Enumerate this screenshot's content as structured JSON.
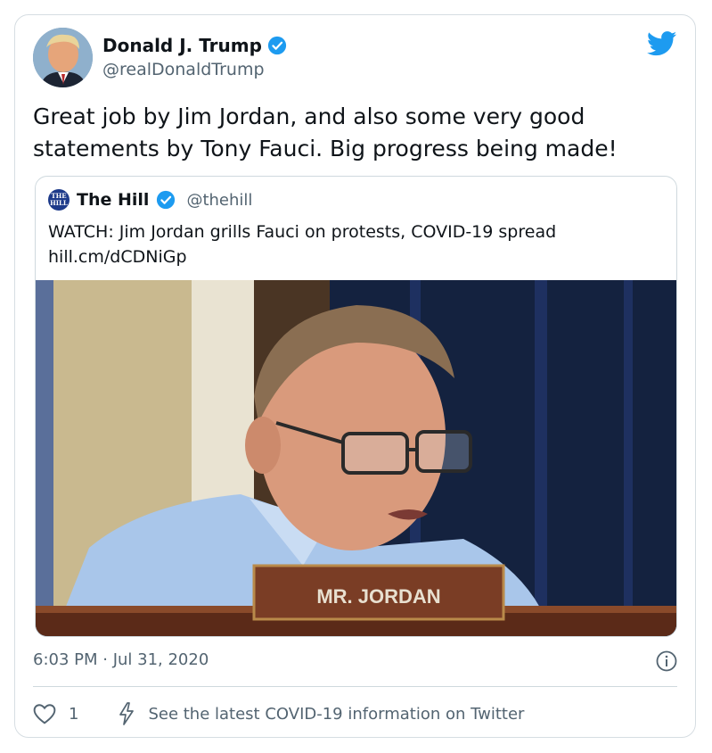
{
  "author": {
    "name": "Donald J. Trump",
    "handle": "@realDonaldTrump",
    "avatar_icon": "profile-photo"
  },
  "tweet": {
    "text_line1": "Great job by Jim Jordan, and also some very good",
    "text_line2": "statements by Tony Fauci. Big progress being made!"
  },
  "quoted": {
    "name": "The Hill",
    "handle": "@thehill",
    "logo_line1": "THE",
    "logo_line2": "HILL",
    "text": "WATCH: Jim Jordan grills Fauci on protests, COVID-19 spread",
    "link": "hill.cm/dCDNiGp",
    "image_placard": "MR. JORDAN"
  },
  "meta": {
    "timestamp": "6:03 PM · Jul 31, 2020"
  },
  "actions": {
    "like_count": "1",
    "covid_info": "See the latest COVID-19 information on Twitter"
  },
  "colors": {
    "twitter_blue": "#1d9bf0",
    "text_secondary": "#536471",
    "border": "#cfd9de"
  }
}
